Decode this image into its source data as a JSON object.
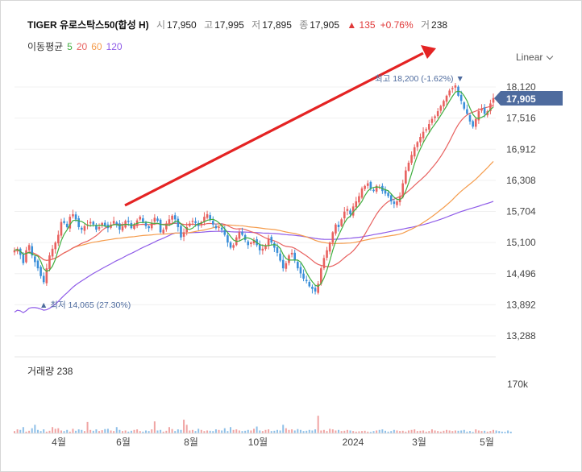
{
  "header": {
    "name": "TIGER 유로스탁스50(합성 H)",
    "open_label": "시",
    "open": "17,950",
    "high_label": "고",
    "high": "17,995",
    "low_label": "저",
    "low": "17,895",
    "close_label": "종",
    "close": "17,905",
    "change": "▲ 135",
    "change_pct": "+0.76%",
    "volume_label": "거",
    "volume": "238"
  },
  "ma_legend": {
    "label": "이동평균",
    "ma5": "5",
    "ma20": "20",
    "ma60": "60",
    "ma120": "120",
    "colors": {
      "ma5": "#3fae3f",
      "ma20": "#e8615f",
      "ma60": "#f59c4c",
      "ma120": "#8f5ce8"
    }
  },
  "scale_selector": "Linear",
  "price_axis": [
    "18,120",
    "17,516",
    "16,912",
    "16,308",
    "15,704",
    "15,100",
    "14,496",
    "13,892",
    "13,288"
  ],
  "current_price_tag": "17,905",
  "high_annotation": "최고 18,200 (-1.62%) ▼",
  "low_annotation": "▲ 최저 14,065 (27.30%)",
  "x_axis": [
    "4월",
    "6월",
    "8월",
    "10월",
    "2024",
    "3월",
    "5월"
  ],
  "volume_panel": {
    "title": "거래량 238",
    "scale": "170k"
  },
  "chart_data": {
    "type": "candlestick",
    "ylim": [
      13288,
      18120
    ],
    "y_ticks": [
      18120,
      17516,
      16912,
      16308,
      15704,
      15100,
      14496,
      13892,
      13288
    ],
    "x_categories": [
      "4월",
      "6월",
      "8월",
      "10월",
      "2024",
      "3월",
      "5월"
    ],
    "candle_up_color": "#e8615f",
    "candle_down_color": "#3a8fd9",
    "close_series": [
      14950,
      14980,
      14860,
      14700,
      14950,
      15050,
      14850,
      14720,
      14600,
      14450,
      14330,
      14600,
      14850,
      14980,
      15100,
      15250,
      15500,
      15480,
      15400,
      15600,
      15650,
      15550,
      15400,
      15350,
      15420,
      15450,
      15500,
      15450,
      15350,
      15400,
      15480,
      15420,
      15380,
      15450,
      15520,
      15460,
      15350,
      15420,
      15520,
      15500,
      15380,
      15430,
      15530,
      15600,
      15500,
      15420,
      15380,
      15480,
      15580,
      15520,
      15300,
      15350,
      15470,
      15550,
      15620,
      15550,
      15400,
      15200,
      15300,
      15400,
      15470,
      15520,
      15480,
      15420,
      15500,
      15600,
      15650,
      15550,
      15450,
      15380,
      15400,
      15350,
      15250,
      15100,
      15000,
      15050,
      15200,
      15300,
      15250,
      15150,
      15050,
      15100,
      15150,
      15050,
      14950,
      14980,
      15050,
      15180,
      15100,
      15000,
      14900,
      14750,
      14600,
      14700,
      14850,
      14900,
      14750,
      14600,
      14500,
      14400,
      14350,
      14250,
      14200,
      14150,
      14300,
      14600,
      14800,
      14950,
      15100,
      15300,
      15450,
      15400,
      15550,
      15700,
      15750,
      15650,
      15800,
      15900,
      16000,
      16150,
      16200,
      16250,
      16150,
      16100,
      16200,
      16180,
      16100,
      16050,
      16000,
      15900,
      15850,
      15900,
      16000,
      16250,
      16500,
      16650,
      16800,
      16950,
      17050,
      17150,
      17250,
      17300,
      17400,
      17500,
      17550,
      17650,
      17750,
      17850,
      17950,
      18050,
      18100,
      18150,
      17950,
      17850,
      17700,
      17600,
      17450,
      17350,
      17500,
      17650,
      17700,
      17600,
      17650,
      17800,
      17905
    ],
    "volume_series_k": [
      8,
      14,
      12,
      22,
      6,
      9,
      18,
      30,
      12,
      8,
      14,
      6,
      9,
      22,
      16,
      18,
      10,
      8,
      12,
      6,
      16,
      9,
      14,
      12,
      8,
      40,
      12,
      9,
      14,
      8,
      11,
      15,
      16,
      10,
      8,
      22,
      12,
      8,
      10,
      6,
      9,
      12,
      14,
      8,
      6,
      10,
      8,
      14,
      42,
      10,
      12,
      6,
      9,
      22,
      15,
      8,
      14,
      12,
      48,
      30,
      10,
      12,
      8,
      16,
      12,
      8,
      10,
      9,
      8,
      14,
      12,
      10,
      18,
      8,
      22,
      12,
      14,
      10,
      8,
      9,
      12,
      10,
      16,
      24,
      10,
      8,
      12,
      14,
      8,
      9,
      12,
      10,
      30,
      18,
      12,
      14,
      10,
      15,
      12,
      8,
      9,
      12,
      10,
      14,
      62,
      10,
      12,
      8,
      16,
      14,
      10,
      12,
      8,
      9,
      12,
      10,
      8,
      6,
      7,
      8,
      9,
      6,
      5,
      8,
      10,
      12,
      14,
      9,
      6,
      8,
      12,
      10,
      8,
      9,
      6,
      10,
      12,
      14,
      8,
      9,
      10,
      6,
      8,
      14,
      10,
      8,
      6,
      9,
      12,
      10,
      8,
      10,
      9,
      10,
      12,
      6,
      8,
      5,
      14,
      10,
      8,
      9,
      6,
      8,
      12,
      10,
      8,
      6,
      5,
      10,
      6
    ]
  }
}
